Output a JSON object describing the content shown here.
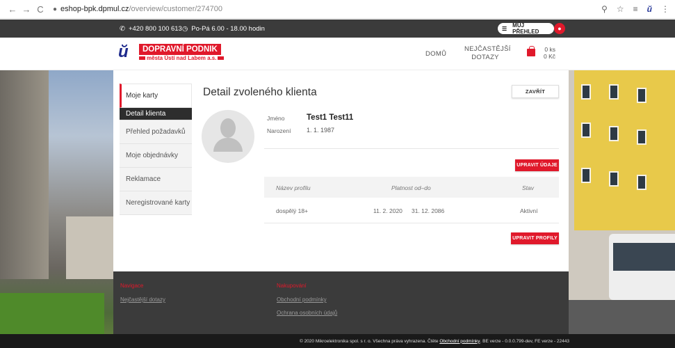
{
  "browser": {
    "back": "←",
    "forward": "→",
    "reload": "C",
    "lock": "🔒",
    "url_host": "eshop-bpk.dpmul.cz",
    "url_path": "/overview/customer/274700",
    "icons": [
      "zoom-icon",
      "star-icon",
      "playlist-icon",
      "extension-icon",
      "menu-icon"
    ]
  },
  "topbar": {
    "phone": "+420 800 100 613",
    "hours": "Po-Pá 6.00 - 18.00 hodin",
    "overview_label": "MŮJ PŘEHLED"
  },
  "header": {
    "logo_title": "DOPRAVNÍ PODNIK",
    "logo_subtitle": "města Ústí nad Labem a.s.",
    "nav_home": "DOMŮ",
    "nav_faq_line1": "NEJČASTĚJŠÍ",
    "nav_faq_line2": "DOTAZY",
    "cart_count": "0 ks",
    "cart_total": "0 Kč"
  },
  "sidebar": {
    "items": [
      {
        "label": "Moje karty"
      },
      {
        "label": "Detail klienta"
      },
      {
        "label": "Přehled požadavků"
      },
      {
        "label": "Moje objednávky"
      },
      {
        "label": "Reklamace"
      },
      {
        "label": "Neregistrované karty"
      }
    ]
  },
  "detail": {
    "title": "Detail zvoleného klienta",
    "close_label": "ZAVŘÍT",
    "name_label": "Jméno",
    "name_value": "Test1 Test11",
    "birth_label": "Narození",
    "birth_value": "1. 1. 1987",
    "edit_details_label": "UPRAVIT ÚDAJE",
    "edit_profiles_label": "UPRAVIT PROFILY"
  },
  "profiles": {
    "columns": [
      "Název profilu",
      "Platnost od–do",
      "Stav"
    ],
    "rows": [
      {
        "name": "dospělý 18+",
        "from": "11. 2. 2020",
        "to": "31. 12. 2086",
        "status": "Aktivní"
      }
    ]
  },
  "footer": {
    "nav_heading": "Navigace",
    "nav_links": [
      "Nejčastější dotazy"
    ],
    "shop_heading": "Nakupování",
    "shop_links": [
      "Obchodní podmínky",
      "Ochrana osobních údajů"
    ],
    "copyright_prefix": "© 2020 Mikroelektronika spol. s r. o. Všechna práva vyhrazena. Čtěte",
    "copyright_link": "Obchodní podmínky",
    "copyright_suffix": ". BE verze - 0.0.0.799-dev, FE verze - 22443"
  },
  "colors": {
    "brand_red": "#e0192b",
    "brand_blue": "#1e2a8c",
    "dark_bar": "#3b3b3b"
  }
}
